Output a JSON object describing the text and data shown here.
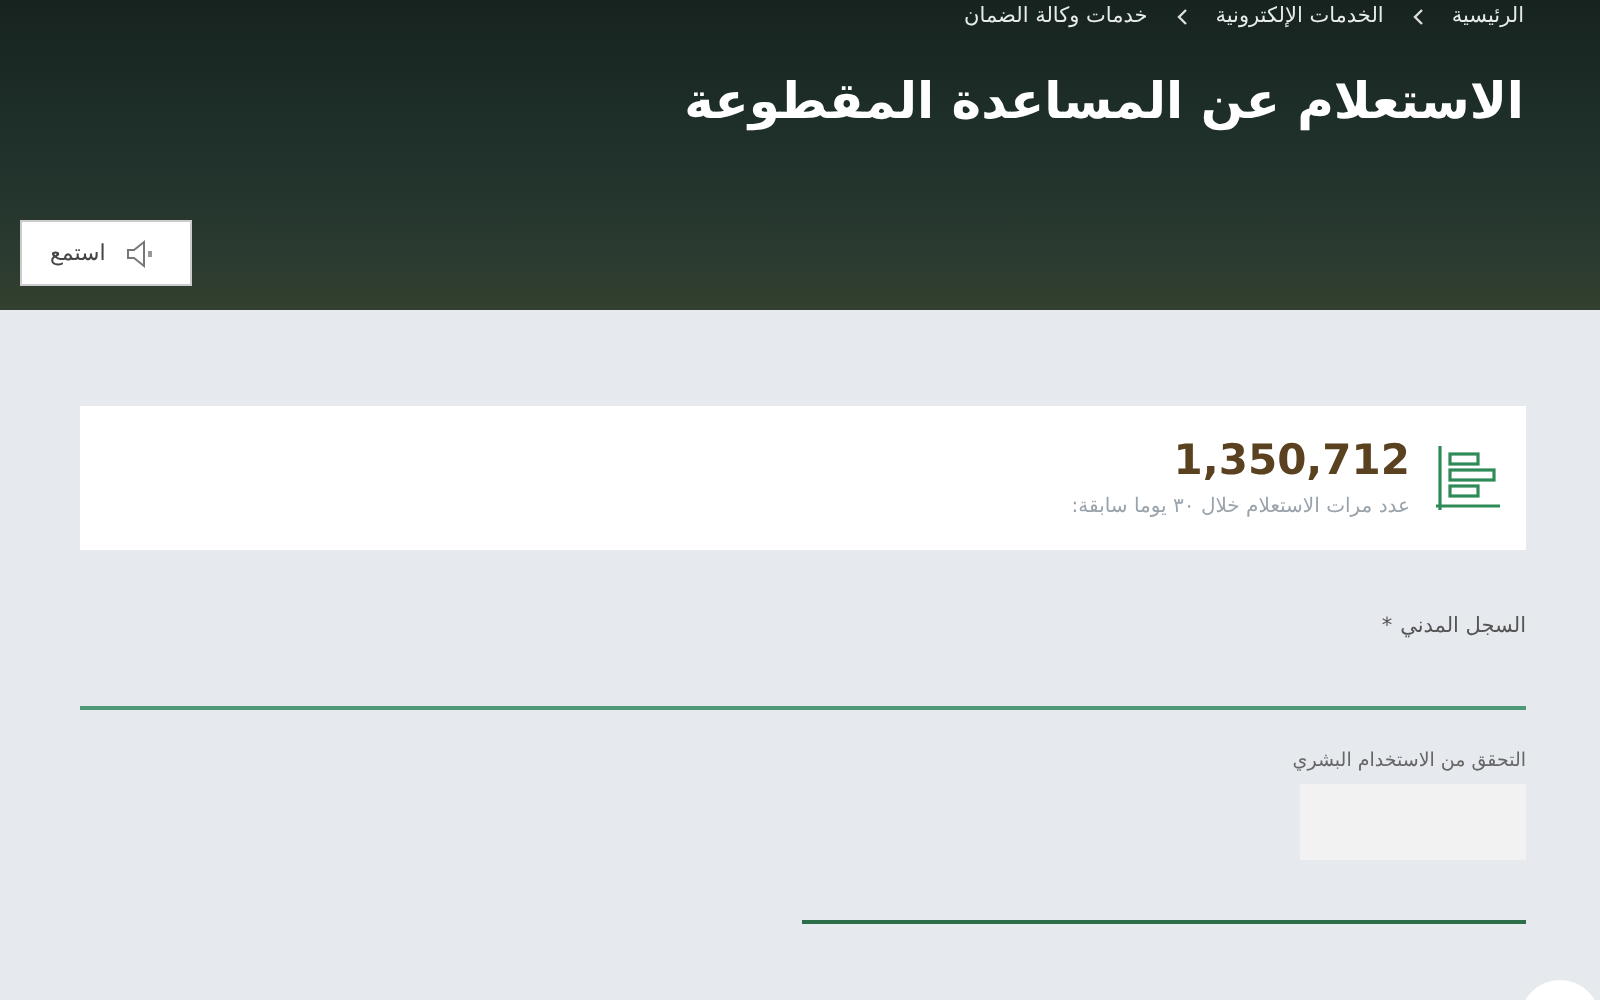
{
  "breadcrumb": [
    {
      "label": "الرئيسية"
    },
    {
      "label": "الخدمات الإلكترونية"
    },
    {
      "label": "خدمات وكالة الضمان"
    }
  ],
  "page_title": "الاستعلام عن المساعدة المقطوعة",
  "listen_button": {
    "label": "استمع"
  },
  "stat": {
    "value": "1,350,712",
    "caption": "عدد مرات الاستعلام خلال ٣٠ يوما سابقة:"
  },
  "form": {
    "fields": [
      {
        "kind": "text",
        "label": "السجل المدني",
        "required_mark": "*"
      },
      {
        "kind": "captcha",
        "label": "التحقق من الاستخدام البشري"
      }
    ]
  }
}
